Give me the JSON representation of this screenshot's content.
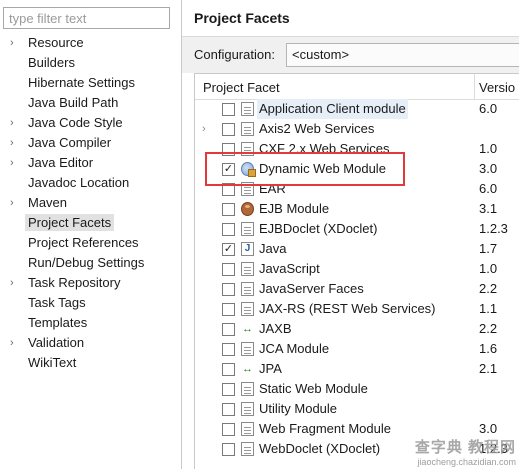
{
  "filter": {
    "placeholder": "type filter text"
  },
  "nav_items": [
    {
      "label": "Resource",
      "has_children": true,
      "selected": false
    },
    {
      "label": "Builders",
      "has_children": false,
      "selected": false
    },
    {
      "label": "Hibernate Settings",
      "has_children": false,
      "selected": false
    },
    {
      "label": "Java Build Path",
      "has_children": false,
      "selected": false
    },
    {
      "label": "Java Code Style",
      "has_children": true,
      "selected": false
    },
    {
      "label": "Java Compiler",
      "has_children": true,
      "selected": false
    },
    {
      "label": "Java Editor",
      "has_children": true,
      "selected": false
    },
    {
      "label": "Javadoc Location",
      "has_children": false,
      "selected": false
    },
    {
      "label": "Maven",
      "has_children": true,
      "selected": false
    },
    {
      "label": "Project Facets",
      "has_children": false,
      "selected": true
    },
    {
      "label": "Project References",
      "has_children": false,
      "selected": false
    },
    {
      "label": "Run/Debug Settings",
      "has_children": false,
      "selected": false
    },
    {
      "label": "Task Repository",
      "has_children": true,
      "selected": false
    },
    {
      "label": "Task Tags",
      "has_children": false,
      "selected": false
    },
    {
      "label": "Templates",
      "has_children": false,
      "selected": false
    },
    {
      "label": "Validation",
      "has_children": true,
      "selected": false
    },
    {
      "label": "WikiText",
      "has_children": false,
      "selected": false
    }
  ],
  "page": {
    "title": "Project Facets",
    "configuration_label": "Configuration:",
    "configuration_value": "<custom>"
  },
  "table": {
    "col_facet": "Project Facet",
    "col_version": "Versio"
  },
  "facets": [
    {
      "name": "Application Client module",
      "version": "6.0",
      "checked": false,
      "icon": "document-icon",
      "expandable": false,
      "highlight": true
    },
    {
      "name": "Axis2 Web Services",
      "version": "",
      "checked": false,
      "icon": "document-icon",
      "expandable": true,
      "highlight": false
    },
    {
      "name": "CXF 2.x Web Services",
      "version": "1.0",
      "checked": false,
      "icon": "document-icon",
      "expandable": false,
      "highlight": false
    },
    {
      "name": "Dynamic Web Module",
      "version": "3.0",
      "checked": true,
      "icon": "web-module-icon",
      "expandable": false,
      "highlight": false
    },
    {
      "name": "EAR",
      "version": "6.0",
      "checked": false,
      "icon": "document-icon",
      "expandable": false,
      "highlight": false
    },
    {
      "name": "EJB Module",
      "version": "3.1",
      "checked": false,
      "icon": "bean-icon",
      "expandable": false,
      "highlight": false
    },
    {
      "name": "EJBDoclet (XDoclet)",
      "version": "1.2.3",
      "checked": false,
      "icon": "document-icon",
      "expandable": false,
      "highlight": false
    },
    {
      "name": "Java",
      "version": "1.7",
      "checked": true,
      "icon": "java-icon",
      "expandable": false,
      "highlight": false
    },
    {
      "name": "JavaScript",
      "version": "1.0",
      "checked": false,
      "icon": "document-icon",
      "expandable": false,
      "highlight": false
    },
    {
      "name": "JavaServer Faces",
      "version": "2.2",
      "checked": false,
      "icon": "document-icon",
      "expandable": false,
      "highlight": false
    },
    {
      "name": "JAX-RS (REST Web Services)",
      "version": "1.1",
      "checked": false,
      "icon": "document-icon",
      "expandable": false,
      "highlight": false
    },
    {
      "name": "JAXB",
      "version": "2.2",
      "checked": false,
      "icon": "xml-binding-icon",
      "expandable": false,
      "highlight": false
    },
    {
      "name": "JCA Module",
      "version": "1.6",
      "checked": false,
      "icon": "document-icon",
      "expandable": false,
      "highlight": false
    },
    {
      "name": "JPA",
      "version": "2.1",
      "checked": false,
      "icon": "xml-binding-icon",
      "expandable": false,
      "highlight": false
    },
    {
      "name": "Static Web Module",
      "version": "",
      "checked": false,
      "icon": "document-icon",
      "expandable": false,
      "highlight": false
    },
    {
      "name": "Utility Module",
      "version": "",
      "checked": false,
      "icon": "document-icon",
      "expandable": false,
      "highlight": false
    },
    {
      "name": "Web Fragment Module",
      "version": "3.0",
      "checked": false,
      "icon": "document-icon",
      "expandable": false,
      "highlight": false
    },
    {
      "name": "WebDoclet (XDoclet)",
      "version": "1.2.3",
      "checked": false,
      "icon": "document-icon",
      "expandable": false,
      "highlight": false
    }
  ],
  "watermark": {
    "line1": "查字典 教程网",
    "line2": "jiaocheng.chazidian.com"
  },
  "colors": {
    "annotation": "#e03a3a",
    "selection": "#e1e1e1",
    "highlight": "#e6eef8"
  }
}
